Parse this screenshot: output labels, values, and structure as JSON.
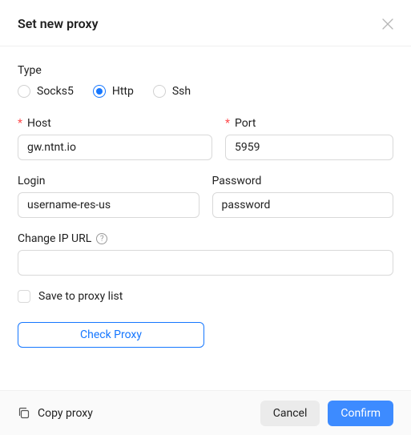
{
  "header": {
    "title": "Set new proxy"
  },
  "type": {
    "label": "Type",
    "options": [
      "Socks5",
      "Http",
      "Ssh"
    ],
    "selected_index": 1
  },
  "fields": {
    "host": {
      "label": "Host",
      "value": "gw.ntnt.io",
      "required": true
    },
    "port": {
      "label": "Port",
      "value": "5959",
      "required": true
    },
    "login": {
      "label": "Login",
      "value": "username-res-us"
    },
    "password": {
      "label": "Password",
      "value": "password"
    },
    "change_ip_url": {
      "label": "Change IP URL",
      "value": ""
    }
  },
  "save_to_list": {
    "label": "Save to proxy list",
    "checked": false
  },
  "buttons": {
    "check_proxy": "Check Proxy",
    "copy_proxy": "Copy proxy",
    "cancel": "Cancel",
    "confirm": "Confirm"
  }
}
